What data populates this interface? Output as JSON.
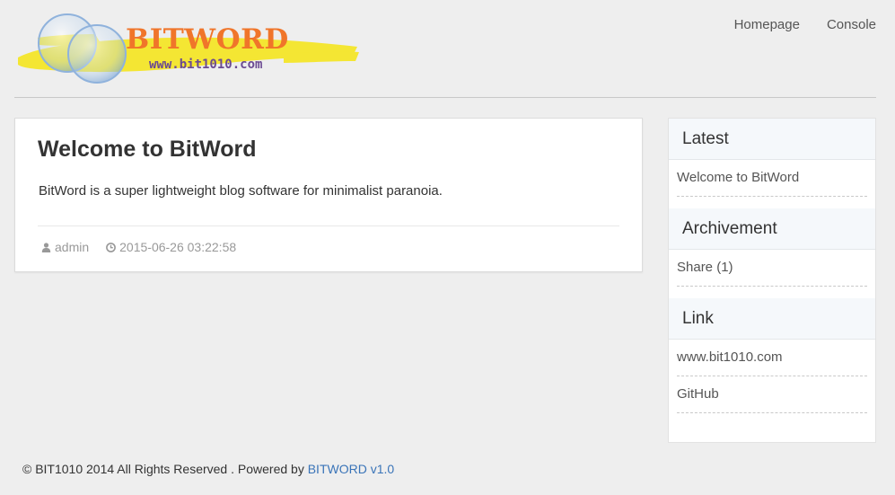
{
  "header": {
    "logo_title": "BITWORD",
    "logo_url": "www.bit1010.com",
    "nav": [
      {
        "label": "Homepage"
      },
      {
        "label": "Console"
      }
    ]
  },
  "post": {
    "title": "Welcome to BitWord",
    "body": "BitWord is a super lightweight blog software for minimalist paranoia.",
    "author": "admin",
    "date": "2015-06-26 03:22:58"
  },
  "sidebar": {
    "latest": {
      "heading": "Latest",
      "items": [
        "Welcome to BitWord"
      ]
    },
    "archive": {
      "heading": "Archivement",
      "items": [
        "Share (1)"
      ]
    },
    "links": {
      "heading": "Link",
      "items": [
        "www.bit1010.com",
        "GitHub"
      ]
    }
  },
  "footer": {
    "text": "© BIT1010 2014 All Rights Reserved . Powered by ",
    "link": "BITWORD v1.0"
  },
  "icons": {
    "author": "user-icon",
    "date": "clock-icon"
  },
  "colors": {
    "logo_orange": "#f0752a",
    "link_blue": "#3a74b8",
    "background": "#eeeeee"
  }
}
